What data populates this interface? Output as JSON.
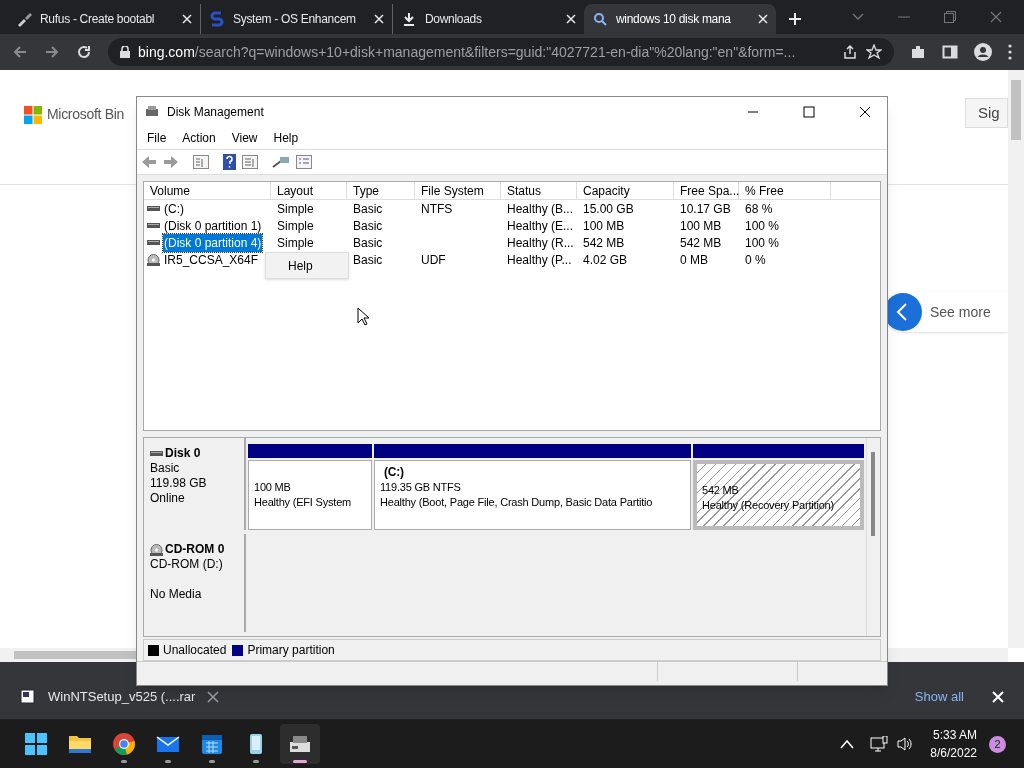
{
  "browser": {
    "tabs": [
      {
        "title": "Rufus - Create bootabl",
        "kind": "brush",
        "selected": false
      },
      {
        "title": "System - OS Enhancem",
        "kind": "site",
        "selected": false
      },
      {
        "title": "Downloads",
        "kind": "download",
        "selected": false
      },
      {
        "title": "windows 10 disk mana",
        "kind": "search",
        "selected": true
      }
    ],
    "url_host": "bing.com",
    "url_path": "/search?q=windows+10+disk+management&filters=guid:\"4027721-en-dia\"%20lang:\"en\"&form=..."
  },
  "page": {
    "logo_text": "Microsoft Bin",
    "sign_in": "Sig",
    "see_more": "See more"
  },
  "disk_management": {
    "title": "Disk Management",
    "menu": [
      "File",
      "Action",
      "View",
      "Help"
    ],
    "columns": [
      "Volume",
      "Layout",
      "Type",
      "File System",
      "Status",
      "Capacity",
      "Free Spa...",
      "% Free"
    ],
    "rows": [
      {
        "kind": "drive",
        "selected": false,
        "cells": [
          " (C:)",
          "Simple",
          "Basic",
          "NTFS",
          "Healthy (B...",
          "15.00 GB",
          "10.17 GB",
          "68 %"
        ]
      },
      {
        "kind": "drive",
        "selected": false,
        "cells": [
          "(Disk 0 partition 1)",
          "Simple",
          "Basic",
          "",
          "Healthy (E...",
          "100 MB",
          "100 MB",
          "100 %"
        ]
      },
      {
        "kind": "drive",
        "selected": true,
        "cells": [
          "(Disk 0 partition 4)",
          "Simple",
          "Basic",
          "",
          "Healthy (R...",
          "542 MB",
          "542 MB",
          "100 %"
        ]
      },
      {
        "kind": "cd",
        "selected": false,
        "cells": [
          "IR5_CCSA_X64F",
          "",
          "Basic",
          "UDF",
          "Healthy (P...",
          "4.02 GB",
          "0 MB",
          "0 %"
        ]
      }
    ],
    "context_menu": [
      "Help"
    ],
    "disks": [
      {
        "kind": "drive",
        "name": "Disk 0",
        "lines": [
          "Basic",
          "119.98 GB",
          "Online"
        ],
        "partitions": [
          {
            "size": "100 MB",
            "status": "Healthy (EFI System",
            "selected": false
          },
          {
            "label": "(C:)",
            "size": "119.35 GB NTFS",
            "status": "Healthy (Boot, Page File, Crash Dump, Basic Data Partitio",
            "selected": false
          },
          {
            "size": "542 MB",
            "status": "Healthy (Recovery Partition)",
            "selected": true
          }
        ]
      },
      {
        "kind": "cd",
        "name": "CD-ROM 0",
        "lines": [
          "CD-ROM (D:)",
          "No Media"
        ]
      }
    ],
    "legend": [
      {
        "label": "Unallocated",
        "color": "#000000"
      },
      {
        "label": "Primary partition",
        "color": "#000080"
      }
    ]
  },
  "download_bar": {
    "file": "WinNTSetup_v525 (....rar",
    "show_all": "Show all"
  },
  "taskbar": {
    "apps": [
      {
        "kind": "start",
        "running": false,
        "active": false
      },
      {
        "kind": "folder",
        "running": false,
        "active": false
      },
      {
        "kind": "chrome",
        "running": true,
        "active": false
      },
      {
        "kind": "mail",
        "running": true,
        "active": false
      },
      {
        "kind": "calendar",
        "running": true,
        "active": false
      },
      {
        "kind": "phone",
        "running": true,
        "active": false
      },
      {
        "kind": "disk",
        "running": true,
        "active": true
      }
    ],
    "time": "5:33 AM",
    "date": "8/6/2022",
    "notifications": "2"
  }
}
